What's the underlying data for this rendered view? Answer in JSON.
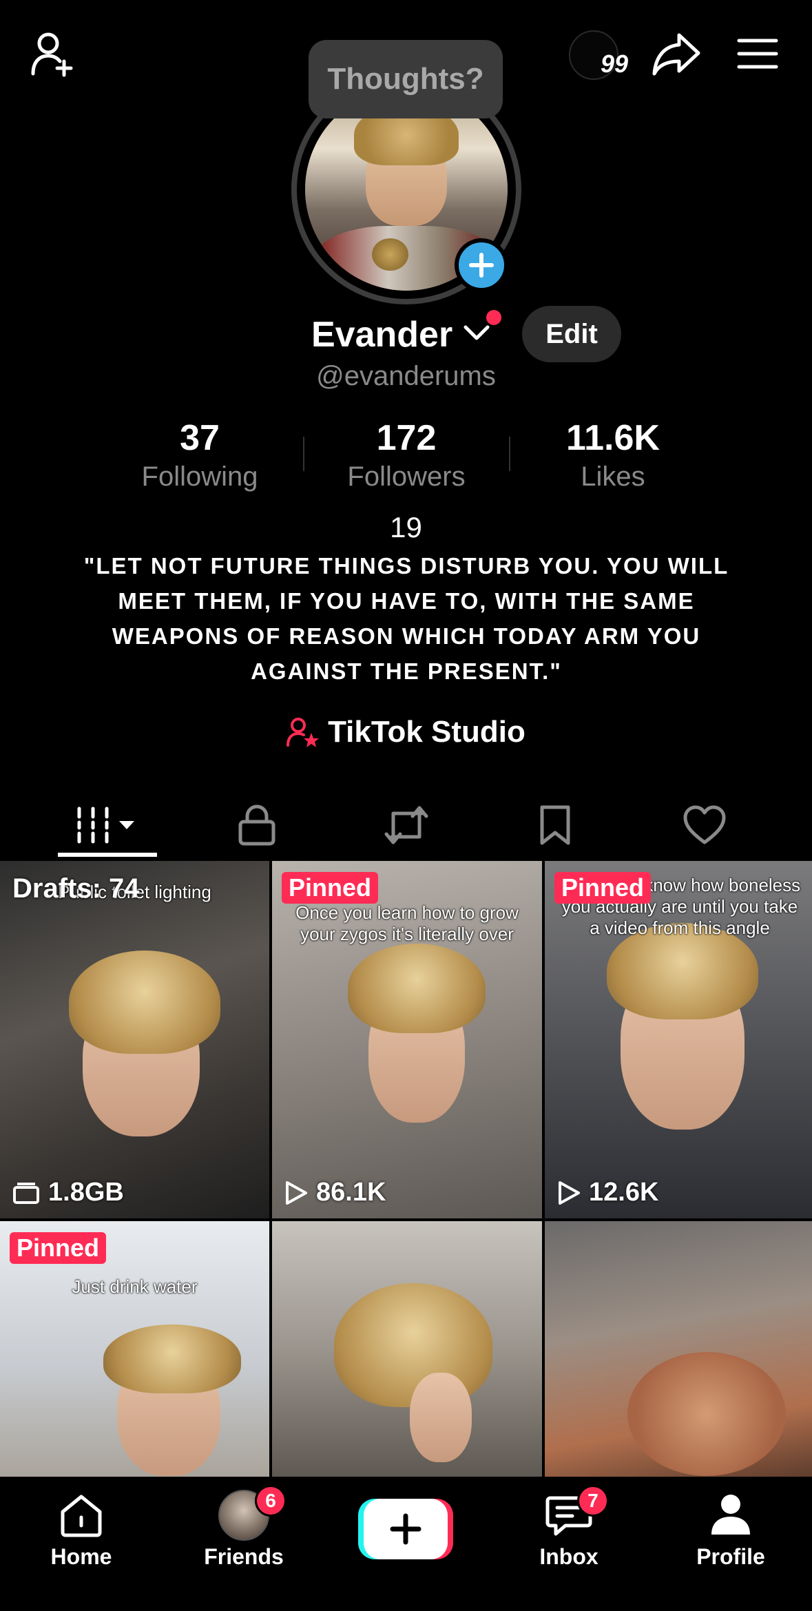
{
  "topbar": {
    "thought_bubble": "Thoughts?",
    "streak_count": "99",
    "icons": [
      "add-friend-icon",
      "share-icon",
      "menu-icon"
    ]
  },
  "profile": {
    "name": "Evander",
    "handle": "@evanderums",
    "edit_label": "Edit",
    "stats": [
      {
        "value": "37",
        "label": "Following"
      },
      {
        "value": "172",
        "label": "Followers"
      },
      {
        "value": "11.6K",
        "label": "Likes"
      }
    ],
    "bio_number": "19",
    "bio": "\"Let not future things disturb you. You will meet them, if you have to, with the same weapons of reason which today arm you against the present.\"",
    "studio_label": "TikTok Studio"
  },
  "tabs": [
    "videos",
    "private",
    "reposts",
    "favorites",
    "liked"
  ],
  "videos": [
    {
      "caption": "Public toilet lighting",
      "overlay": "Drafts: 74",
      "meta": "1.8GB",
      "meta_icon": "drafts-icon"
    },
    {
      "caption": "Once you learn how to grow your zygos it's literally over",
      "pinned": "Pinned",
      "meta": "86.1K",
      "meta_icon": "play-icon"
    },
    {
      "caption": "You never know how boneless you actually are until you take a video from this angle",
      "pinned": "Pinned",
      "meta": "12.6K",
      "meta_icon": "play-icon"
    },
    {
      "caption": "Just drink water",
      "pinned": "Pinned"
    },
    {
      "caption": ""
    },
    {
      "caption": ""
    }
  ],
  "bottom_nav": {
    "home": "Home",
    "friends": "Friends",
    "friends_badge": "6",
    "inbox": "Inbox",
    "inbox_badge": "7",
    "profile": "Profile"
  },
  "colors": {
    "accent": "#fe2c55",
    "cyan": "#25f4ee",
    "background": "#000000"
  }
}
